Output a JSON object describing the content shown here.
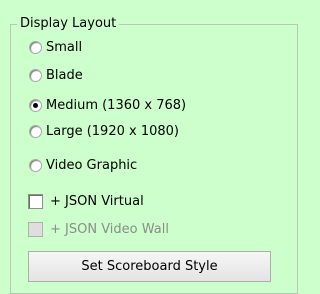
{
  "display_layout": {
    "title": "Display Layout",
    "options": [
      {
        "label": "Small",
        "selected": false
      },
      {
        "label": "Blade",
        "selected": false
      },
      {
        "label": "Medium (1360 x 768)",
        "selected": true
      },
      {
        "label": "Large (1920 x 1080)",
        "selected": false
      },
      {
        "label": "Video Graphic",
        "selected": false
      }
    ],
    "checkboxes": [
      {
        "label": "+ JSON Virtual",
        "checked": false,
        "enabled": true
      },
      {
        "label": "+ JSON Video Wall",
        "checked": false,
        "enabled": false
      }
    ],
    "button_label": "Set Scoreboard Style"
  },
  "colors": {
    "background": "#ccffcc",
    "disabled_text": "#8c8c8c"
  }
}
